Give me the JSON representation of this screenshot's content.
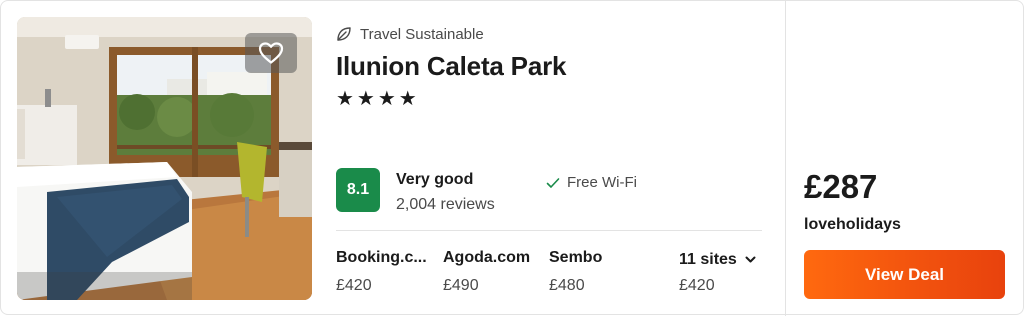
{
  "listing": {
    "sustainability_label": "Travel Sustainable",
    "hotel_name": "Ilunion Caleta Park",
    "stars": "★★★★",
    "star_count": 4,
    "rating": {
      "score": "8.1",
      "label": "Very good",
      "reviews": "2,004 reviews"
    },
    "amenity": "Free Wi-Fi",
    "sites": [
      {
        "name": "Booking.c...",
        "price": "£420"
      },
      {
        "name": "Agoda.com",
        "price": "£490"
      },
      {
        "name": "Sembo",
        "price": "£480"
      }
    ],
    "more_sites": {
      "label": "11 sites",
      "price": "£420"
    },
    "deal": {
      "price": "£287",
      "provider": "loveholidays",
      "button_label": "View Deal"
    }
  },
  "colors": {
    "score_badge": "#1a8b4a",
    "deal_button_start": "#ff690f",
    "deal_button_end": "#e8420d"
  },
  "icons": {
    "sustainable": "leaf-icon",
    "favorite": "heart-icon",
    "amenity": "check-icon",
    "expand": "chevron-down-icon"
  }
}
